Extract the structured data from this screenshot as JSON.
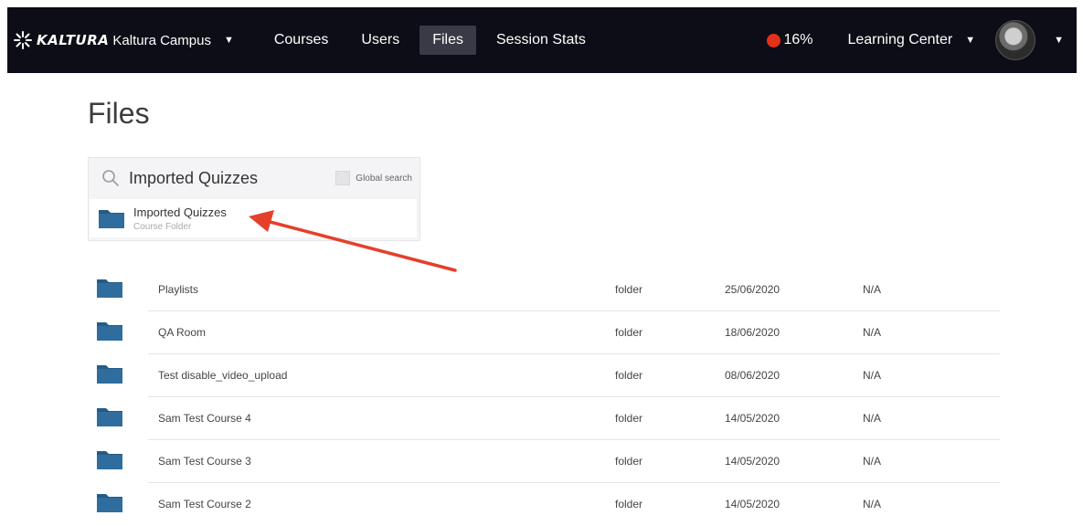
{
  "topbar": {
    "brand_word": "KALTURA",
    "brand_campus": "Kaltura Campus",
    "nav": [
      {
        "label": "Courses"
      },
      {
        "label": "Users"
      },
      {
        "label": "Files",
        "active": true
      },
      {
        "label": "Session Stats"
      }
    ],
    "progress_label": "16%",
    "progress_percent": 16,
    "progress_color": "#e5301b",
    "learning_center": "Learning Center",
    "bar_color": "#0d0d17"
  },
  "page": {
    "title": "Files"
  },
  "search": {
    "value": "Imported Quizzes",
    "global_search_label": "Global search",
    "global_search_checked": false,
    "suggestion": {
      "title": "Imported Quizzes",
      "subtitle": "Course Folder",
      "icon": "folder-icon"
    }
  },
  "annotation": {
    "arrow_color": "#e4402a"
  },
  "files": [
    {
      "name": "Playlists",
      "type": "folder",
      "date": "25/06/2020",
      "size": "N/A"
    },
    {
      "name": "QA Room",
      "type": "folder",
      "date": "18/06/2020",
      "size": "N/A"
    },
    {
      "name": "Test disable_video_upload",
      "type": "folder",
      "date": "08/06/2020",
      "size": "N/A"
    },
    {
      "name": "Sam Test Course 4",
      "type": "folder",
      "date": "14/05/2020",
      "size": "N/A"
    },
    {
      "name": "Sam Test Course 3",
      "type": "folder",
      "date": "14/05/2020",
      "size": "N/A"
    },
    {
      "name": "Sam Test Course 2",
      "type": "folder",
      "date": "14/05/2020",
      "size": "N/A"
    }
  ],
  "colors": {
    "folder": "#2f6d9e",
    "folder_tab": "#255b85"
  }
}
